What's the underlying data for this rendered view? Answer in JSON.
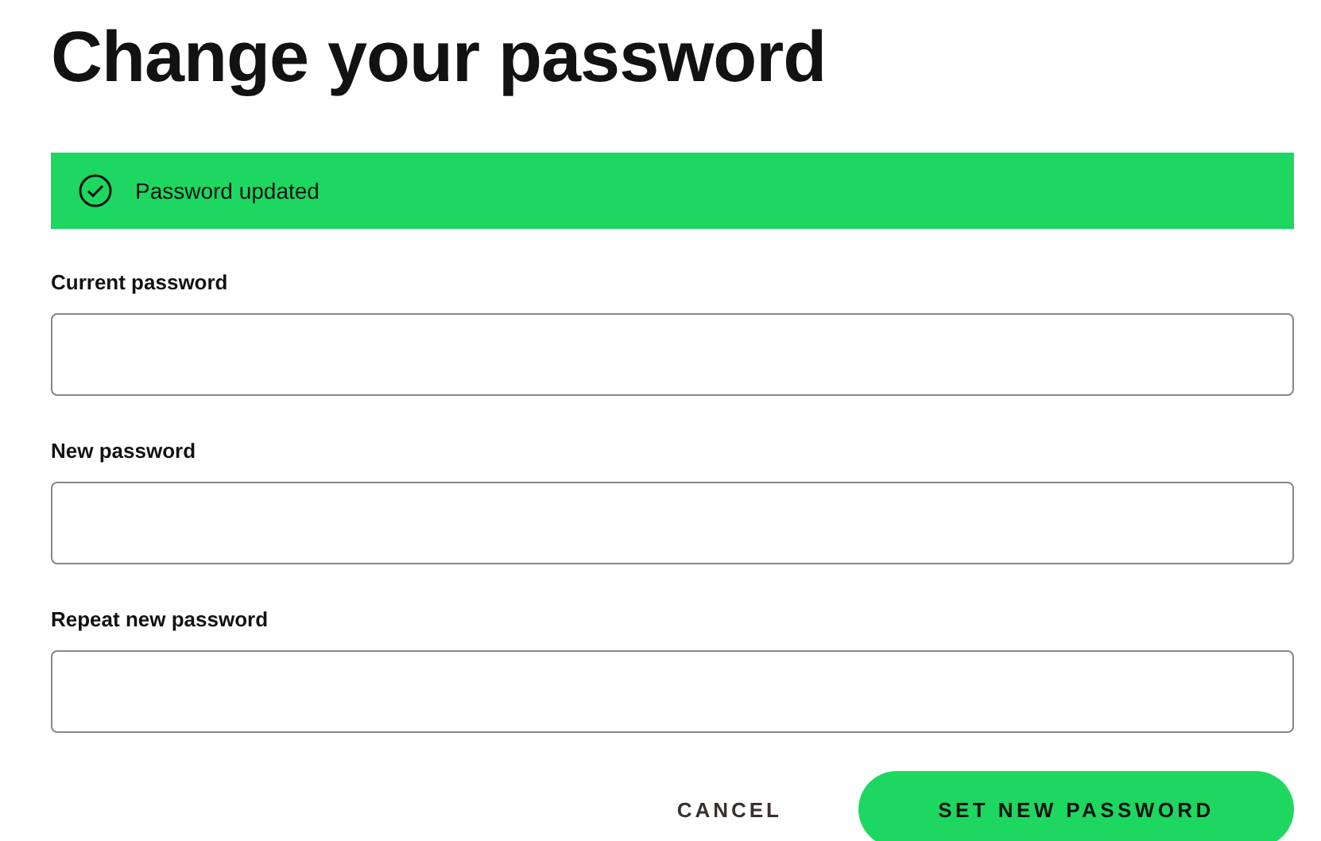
{
  "title": "Change your password",
  "alert": {
    "kind": "success",
    "text": "Password updated"
  },
  "fields": [
    {
      "label": "Current password"
    },
    {
      "label": "New password"
    },
    {
      "label": "Repeat new password"
    }
  ],
  "buttons": {
    "cancel": "CANCEL",
    "submit": "SET NEW PASSWORD"
  }
}
